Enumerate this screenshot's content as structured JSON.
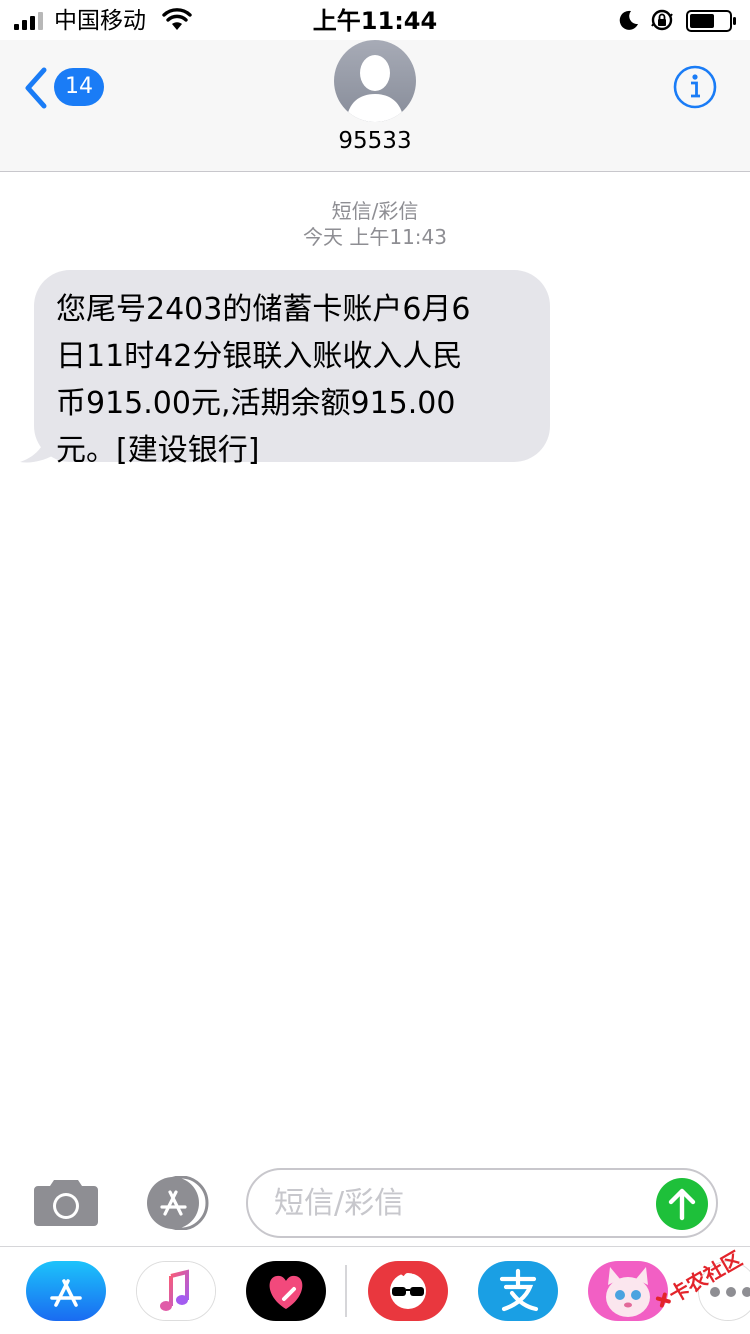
{
  "status_bar": {
    "carrier": "中国移动",
    "time": "上午11:44"
  },
  "header": {
    "back_badge": "14",
    "contact": "95533"
  },
  "thread": {
    "service_label": "短信/彩信",
    "timestamp": "今天 上午11:43",
    "messages": [
      {
        "lines": [
          "您尾号2403的储蓄卡账户6月6",
          "日11时42分银联入账收入人民",
          "币915.00元,活期余额915.00",
          "元。[建设银行]"
        ]
      }
    ]
  },
  "compose": {
    "placeholder": "短信/彩信"
  },
  "app_drawer": {
    "apps": [
      "app-store-icon",
      "music-icon",
      "heart-app-icon",
      "sunglasses-app-icon",
      "alipay-icon",
      "talking-angela-icon",
      "more-icon"
    ]
  },
  "watermark": {
    "text": "卡农社区"
  },
  "colors": {
    "ios_blue": "#1a7cf6",
    "bubble_gray": "#e5e5ea",
    "send_green": "#1ec03a",
    "meta_gray": "#8e8e93"
  }
}
